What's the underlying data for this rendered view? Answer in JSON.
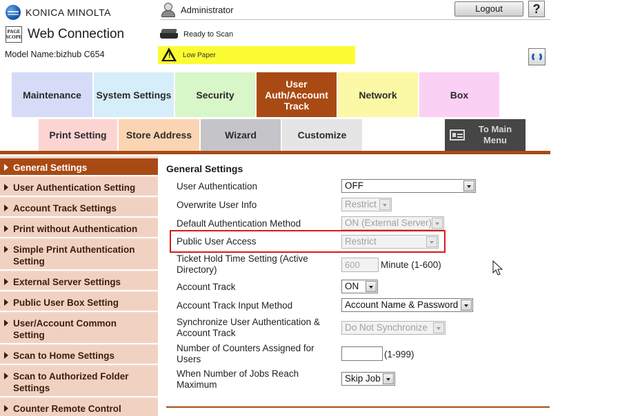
{
  "brand": {
    "company": "KONICA MINOLTA",
    "pagescope_line1": "PAGE",
    "pagescope_line2": "SCOPE",
    "product": "Web Connection",
    "model_name": "Model Name:bizhub C654"
  },
  "header": {
    "user": "Administrator",
    "logout_label": "Logout",
    "help_label": "?",
    "status_text": "Ready to Scan",
    "warning_text": "Low Paper"
  },
  "tabs": [
    {
      "label": "Maintenance"
    },
    {
      "label": "System Settings"
    },
    {
      "label": "Security"
    },
    {
      "label": "User Auth/Account Track"
    },
    {
      "label": "Network"
    },
    {
      "label": "Box"
    }
  ],
  "subtabs": [
    {
      "label": "Print Setting"
    },
    {
      "label": "Store Address"
    },
    {
      "label": "Wizard"
    },
    {
      "label": "Customize"
    }
  ],
  "to_main_menu": "To Main Menu",
  "sidebar": {
    "items": [
      {
        "label": "General Settings",
        "active": true
      },
      {
        "label": "User Authentication Setting"
      },
      {
        "label": "Account Track Settings"
      },
      {
        "label": "Print without Authentication"
      },
      {
        "label": "Simple Print Authentication Setting"
      },
      {
        "label": "External Server Settings"
      },
      {
        "label": "Public User Box Setting"
      },
      {
        "label": "User/Account Common Setting"
      },
      {
        "label": "Scan to Home Settings"
      },
      {
        "label": "Scan to Authorized Folder Settings"
      },
      {
        "label": "Counter Remote Control"
      }
    ]
  },
  "main": {
    "title": "General Settings",
    "fields": [
      {
        "label": "User Authentication",
        "value": "OFF"
      },
      {
        "label": "Overwrite User Info",
        "value": "Restrict"
      },
      {
        "label": "Default Authentication Method",
        "value": "ON (External Server)"
      },
      {
        "label": "Public User Access",
        "value": "Restrict"
      },
      {
        "label": "Ticket Hold Time Setting (Active Directory)",
        "value": "600",
        "suffix": "Minute (1-600)"
      },
      {
        "label": "Account Track",
        "value": "ON"
      },
      {
        "label": "Account Track Input Method",
        "value": "Account Name & Password"
      },
      {
        "label": "Synchronize User Authentication & Account Track",
        "value": "Do Not Synchronize"
      },
      {
        "label": "Number of Counters Assigned for Users",
        "value": "",
        "suffix": "(1-999)"
      },
      {
        "label": "When Number of Jobs Reach Maximum",
        "value": "Skip Job"
      }
    ]
  },
  "colors": {
    "accent": "#a94a14",
    "sidebar_bg": "#f1d2c2",
    "warning_bg": "#fcfc33",
    "highlight": "#d51a1a"
  }
}
